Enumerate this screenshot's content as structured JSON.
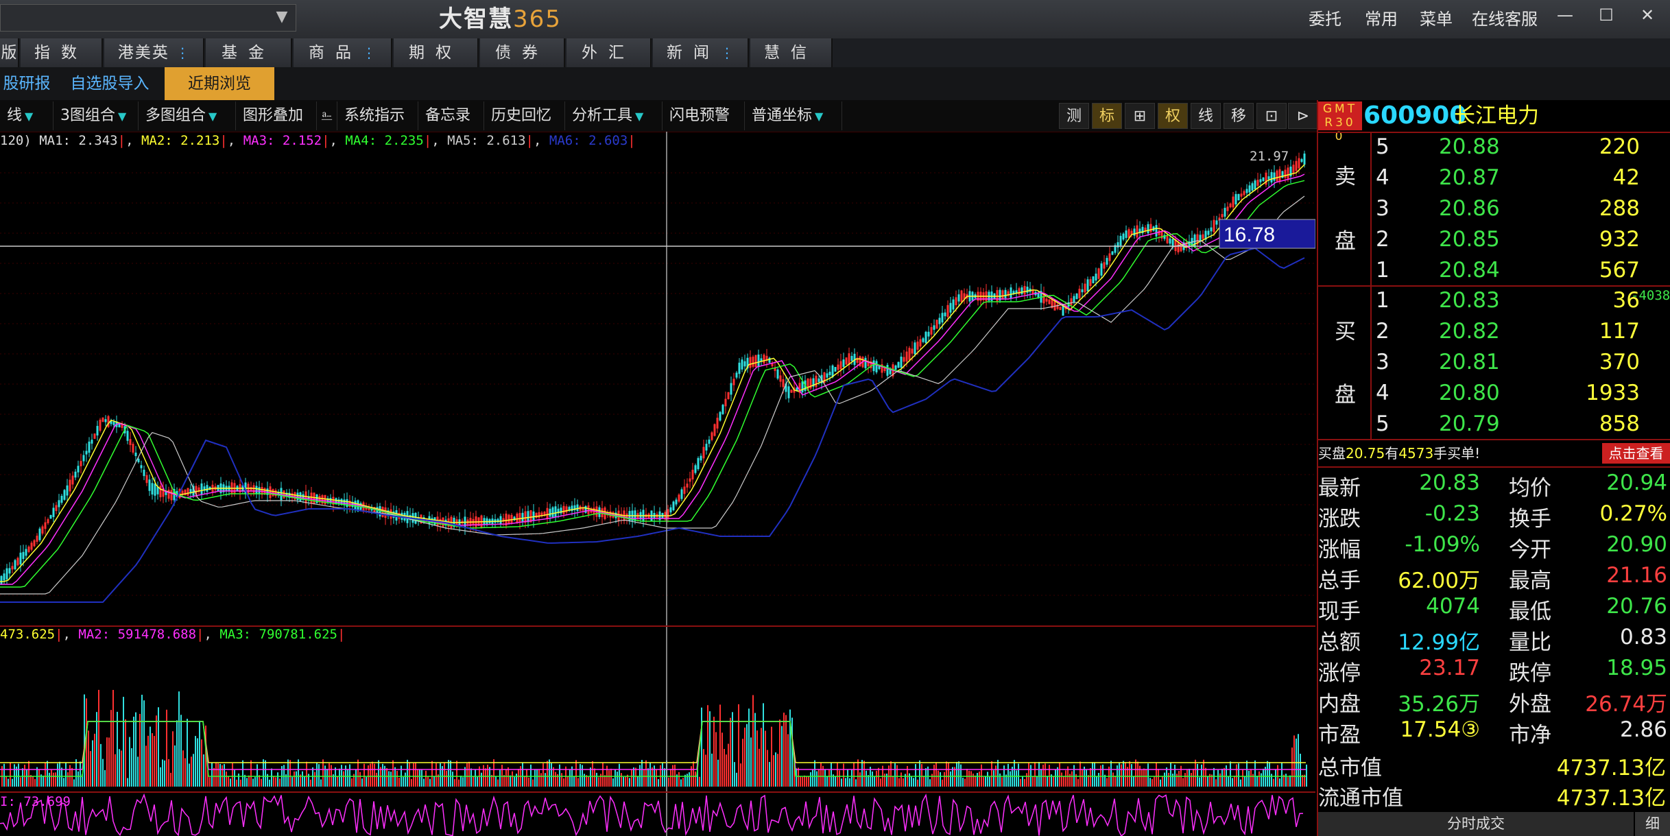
{
  "app": {
    "logo_text": "大智慧",
    "logo_num": "365"
  },
  "title_menu": [
    "委托",
    "常用",
    "菜单",
    "在线客服"
  ],
  "window_buttons": {
    "minimize": "—",
    "maximize": "☐",
    "close": "✕"
  },
  "nav_tabs": [
    "版",
    "指数",
    "港美英",
    "基金",
    "商品",
    "期权",
    "债券",
    "外汇",
    "新闻",
    "慧信"
  ],
  "sub_tabs": [
    "股研报",
    "自选股导入",
    "近期浏览"
  ],
  "toolbar": {
    "items": [
      "线",
      "3图组合",
      "多图组合",
      "图形叠加",
      "系统指示",
      "备忘录",
      "历史回忆",
      "分析工具",
      "闪电预警",
      "普通坐标"
    ],
    "right_buttons": [
      "测",
      "标",
      "⊞",
      "权",
      "线",
      "移",
      "⊡",
      "⊳"
    ]
  },
  "ma_line": {
    "prefix": "120)",
    "ma1": "MA1: 2.343",
    "ma2": "MA2: 2.213",
    "ma3": "MA3: 2.152",
    "ma4": "MA4: 2.235",
    "ma5": "MA5: 2.613",
    "ma6": "MA6: 2.603"
  },
  "vol_line": {
    "ma1": "473.625",
    "ma2": "MA2: 591478.688",
    "ma3": "MA3: 790781.625"
  },
  "ind_line": {
    "label": "I: 73.699"
  },
  "chart": {
    "price_high_label": "21.97",
    "cursor_price": "16.78",
    "colors": {
      "candle_up": "#ff3030",
      "candle_down": "#30e0e0",
      "ma_white": "#cccccc",
      "ma_yellow": "#ffff30",
      "ma_magenta": "#ff30ff",
      "ma_green": "#30ff30",
      "ma_blue": "#2030c0"
    }
  },
  "stock": {
    "tag": "GMTR300",
    "code": "600900",
    "name": "长江电力",
    "sell_label": [
      "卖",
      "盘"
    ],
    "buy_label": [
      "买",
      "盘"
    ],
    "sell": [
      {
        "level": "5",
        "price": "20.88",
        "volume": "220"
      },
      {
        "level": "4",
        "price": "20.87",
        "volume": "42"
      },
      {
        "level": "3",
        "price": "20.86",
        "volume": "288"
      },
      {
        "level": "2",
        "price": "20.85",
        "volume": "932"
      },
      {
        "level": "1",
        "price": "20.84",
        "volume": "567"
      }
    ],
    "buy": [
      {
        "level": "1",
        "price": "20.83",
        "volume": "36"
      },
      {
        "level": "2",
        "price": "20.82",
        "volume": "117"
      },
      {
        "level": "3",
        "price": "20.81",
        "volume": "370"
      },
      {
        "level": "4",
        "price": "20.80",
        "volume": "1933"
      },
      {
        "level": "5",
        "price": "20.79",
        "volume": "858"
      }
    ],
    "buy1_change": "-4038",
    "big_order": {
      "text_a": "买盘",
      "price": "20.75",
      "text_b": "有",
      "count": "4573",
      "text_c": "手买单!",
      "button": "点击查看"
    },
    "stats": [
      {
        "label": "最新",
        "value": "20.83",
        "label2": "均价",
        "value2": "20.94"
      },
      {
        "label": "涨跌",
        "value": "-0.23",
        "label2": "换手",
        "value2": "0.27%"
      },
      {
        "label": "涨幅",
        "value": "-1.09%",
        "label2": "今开",
        "value2": "20.90"
      },
      {
        "label": "总手",
        "value": "62.00万",
        "label2": "最高",
        "value2": "21.16"
      },
      {
        "label": "现手",
        "value": "4074",
        "label2": "最低",
        "value2": "20.76"
      },
      {
        "label": "总额",
        "value": "12.99亿",
        "label2": "量比",
        "value2": "0.83"
      },
      {
        "label": "涨停",
        "value": "23.17",
        "label2": "跌停",
        "value2": "18.95"
      },
      {
        "label": "内盘",
        "value": "35.26万",
        "label2": "外盘",
        "value2": "26.74万"
      },
      {
        "label": "市盈",
        "value": "17.54③",
        "label2": "市净",
        "value2": "2.86"
      }
    ],
    "market_cap_label": "总市值",
    "market_cap": "4737.13亿",
    "float_cap_label": "流通市值",
    "float_cap": "4737.13亿",
    "bottom_tab": "分时成交",
    "bottom_tab2": "细"
  }
}
